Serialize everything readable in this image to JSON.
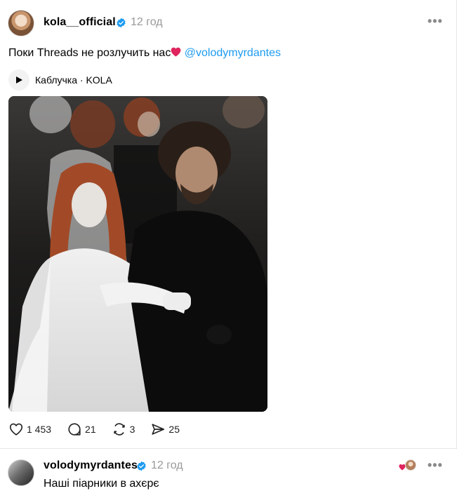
{
  "post": {
    "username": "kola__official",
    "timestamp": "12 год",
    "more_icon": "more-icon",
    "text": "Поки Threads не розлучить нас",
    "emoji": "red-heart",
    "mention": "@volodymyrdantes",
    "music": {
      "label": "Каблучка · KOLA",
      "icon": "play-icon"
    },
    "photo": {
      "description_icon": "photo"
    },
    "actions": {
      "likes": "1 453",
      "comments": "21",
      "reposts": "3",
      "shares": "25"
    }
  },
  "reply": {
    "username": "volodymyrdantes",
    "timestamp": "12 год",
    "text": "Наші піарники в ахєрє"
  },
  "colors": {
    "verified": "#1d9bf0",
    "mention": "#1d9bf0",
    "heart": "#e0245e",
    "muted": "#999999"
  }
}
